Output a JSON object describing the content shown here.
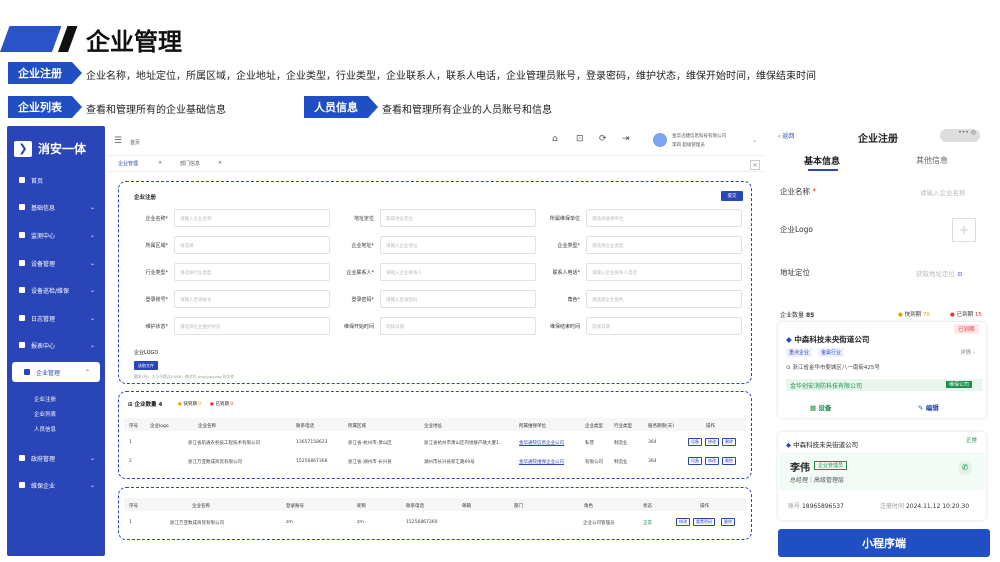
{
  "header": {
    "title": "企业管理"
  },
  "tags": [
    {
      "label": "企业注册",
      "desc": "企业名称，地址定位，所属区域，企业地址，企业类型，行业类型，企业联系人，联系人电话，企业管理员账号，登录密码，维护状态，维保开始时间，维保结束时间"
    },
    {
      "label": "企业列表",
      "desc": "查看和管理所有的企业基础信息"
    },
    {
      "label": "人员信息",
      "desc": "查看和管理所有企业的人员账号和信息"
    }
  ],
  "sidebar": {
    "brand": "消安一体",
    "items": [
      {
        "label": "首页"
      },
      {
        "label": "基础信息"
      },
      {
        "label": "监测中心"
      },
      {
        "label": "设备管理"
      },
      {
        "label": "设备巡检/维保"
      },
      {
        "label": "日志管理"
      },
      {
        "label": "报表中心"
      },
      {
        "label": "企业管理"
      },
      {
        "label": "政府管理"
      },
      {
        "label": "维保企业"
      }
    ],
    "subitems": [
      "企业注册",
      "企业列表",
      "人员信息"
    ]
  },
  "topbar": {
    "home": "首页",
    "company": "金华迅捷信息科技有限公司",
    "user": "李四  超级管理员"
  },
  "tabs": [
    "企业管理",
    "部门信息"
  ],
  "form": {
    "title": "企业注册",
    "submit": "提交",
    "fields": [
      {
        "label": "企业名称*",
        "ph": "请输入企业名称"
      },
      {
        "label": "地址定位",
        "ph": "获取地址定位"
      },
      {
        "label": "所属维保单位",
        "ph": "请选择维保单位"
      },
      {
        "label": "所属区域*",
        "ph": "请选择"
      },
      {
        "label": "企业地址*",
        "ph": "请输入企业地址"
      },
      {
        "label": "企业类型*",
        "ph": "请选择企业类型"
      },
      {
        "label": "行业类型*",
        "ph": "请选择行业类型"
      },
      {
        "label": "企业联系人*",
        "ph": "请输入企业联系人"
      },
      {
        "label": "联系人电话*",
        "ph": "请输入企业联系人电话"
      },
      {
        "label": "登录账号*",
        "ph": "请输入登录账号"
      },
      {
        "label": "登录密码*",
        "ph": "请输入登录密码"
      },
      {
        "label": "角色*",
        "ph": "请选择企业角色"
      },
      {
        "label": "维护状态*",
        "ph": "请选择企业维护状态"
      },
      {
        "label": "维保开始时间",
        "ph": "选择日期"
      },
      {
        "label": "维保结束时间",
        "ph": "选择日期"
      }
    ],
    "logo_label": "企业LOGO",
    "upload": "选取文件",
    "upload_hint": "最多1份，大小不超过10MB，格式为 png/jpg/jpeg 的文件"
  },
  "list": {
    "title": "企业数量",
    "count": "4",
    "stat1_label": "快到期",
    "stat1": "0",
    "stat2_label": "已到期",
    "stat2": "0",
    "headers": [
      "序号",
      "企业logo",
      "企业名称",
      "联系电话",
      "所属区域",
      "企业地址",
      "所属维保单位",
      "企业类型",
      "行业类型",
      "服务期限(天)",
      "操作"
    ],
    "rows": [
      [
        "1",
        "",
        "浙江省航通农机技工程技术有限公司",
        "13657158623",
        "浙江省-杭州市-萧山区",
        "浙江省杭州市萧山区内地联产融大厦1..",
        "金华通院信息企业公司",
        "私营",
        "制造业",
        "364"
      ],
      [
        "2",
        "",
        "浙江万亚数成商贸有限公司",
        "15256867368",
        "浙江省-湖州市-长兴县",
        "湖州市长兴县新汇路69号",
        "金华通院维保企业公司",
        "有限公司",
        "制造业",
        "364"
      ]
    ],
    "actions": [
      "设备",
      "修改",
      "删除"
    ]
  },
  "people": {
    "headers": [
      "序号",
      "企业名称",
      "登录账号",
      "昵称",
      "联系电话",
      "邮箱",
      "部门",
      "角色",
      "状态",
      "操作"
    ],
    "row": [
      "1",
      "浙江万亚数成商贸有限公司",
      "zm",
      "zm",
      "15256867360",
      "",
      "",
      "企业公司管理员",
      "正常"
    ],
    "actions": [
      "修改",
      "重置密码",
      "删除"
    ]
  },
  "phone": {
    "back": "返回",
    "title": "企业注册",
    "tab1": "基本信息",
    "tab2": "其他信息",
    "name_label": "企业名称",
    "name_ph": "请输入企业名称",
    "logo_label": "企业Logo",
    "addr_label": "地址定位",
    "addr_ph": "获取地址定位",
    "count_label": "企业数量",
    "count": "85",
    "soon_label": "快到期",
    "soon": "70",
    "expired_label": "已到期",
    "expired": "15",
    "card1": {
      "name": "中森科技未央街道公司",
      "badge": "已到期",
      "tags": [
        "重点企业",
        "金属行业"
      ],
      "detail": "详情",
      "addr": "浙江省金华市婺城区八一南街425号",
      "maint": "金华创安消防科技有限公司",
      "maint_tag": "维保公司",
      "btn1": "设备",
      "btn2": "编辑"
    },
    "card2": {
      "company": "中森科技未央街道公司",
      "status": "正常",
      "person": "李伟",
      "role_tag": "企业管理员",
      "title": "总经理｜高级管理层",
      "acct_label": "账号",
      "acct": "18965896537",
      "time_label": "注册时间",
      "time": "2024.11.12 10:20.30"
    },
    "mini": "小程序端"
  }
}
